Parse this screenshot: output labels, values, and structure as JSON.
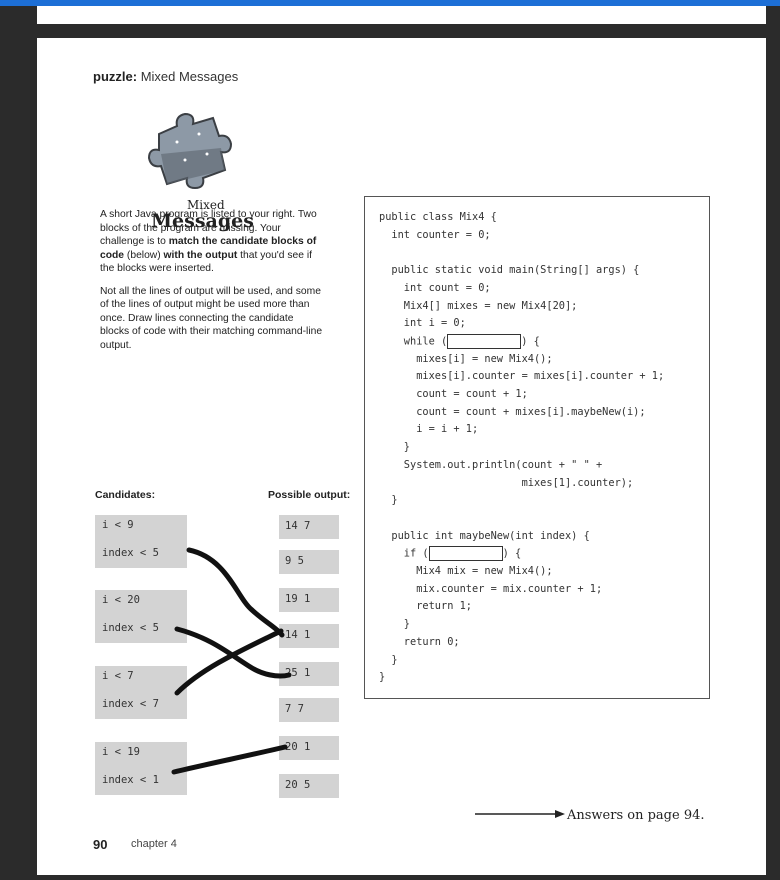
{
  "header": {
    "section": "puzzle:",
    "title": "Mixed Messages"
  },
  "logo": {
    "line1": "Mixed",
    "line2": "Messages"
  },
  "intro": {
    "p1_a": "A short Java program is listed to your right. Two blocks of the program are missing. Your challenge is to ",
    "p1_b": "match the candidate blocks of code",
    "p1_c": " (below) ",
    "p1_d": "with the output",
    "p1_e": " that you'd see if the blocks were inserted.",
    "p2": "Not all the lines of output will be used, and some of the lines of output might be used more than once.  Draw lines connecting the candidate blocks of code with their matching command-line output."
  },
  "code_lines": [
    "public class Mix4 {",
    "  int counter = 0;",
    "",
    "  public static void main(String[] args) {",
    "    int count = 0;",
    "    Mix4[] mixes = new Mix4[20];",
    "    int i = 0;",
    "    while (",
    "      mixes[i] = new Mix4();",
    "      mixes[i].counter = mixes[i].counter + 1;",
    "      count = count + 1;",
    "      count = count + mixes[i].maybeNew(i);",
    "      i = i + 1;",
    "    }",
    "    System.out.println(count + \" \" +",
    "                       mixes[1].counter);",
    "  }",
    "",
    "  public int maybeNew(int index) {",
    "    if (",
    "      Mix4 mix = new Mix4();",
    "      mix.counter = mix.counter + 1;",
    "      return 1;",
    "    }",
    "    return 0;",
    "  }",
    "}"
  ],
  "blank_close": ") {",
  "candidates_label": "Candidates:",
  "output_label": "Possible output:",
  "candidates": [
    {
      "a": "i < 9",
      "b": "index < 5"
    },
    {
      "a": "i < 20",
      "b": "index < 5"
    },
    {
      "a": "i < 7",
      "b": "index < 7"
    },
    {
      "a": "i < 19",
      "b": "index < 1"
    }
  ],
  "outputs": [
    "14 7",
    "9 5",
    "19 1",
    "14 1",
    "25 1",
    "7 7",
    "20 1",
    "20 5"
  ],
  "footer": {
    "page": "90",
    "chapter": "chapter 4"
  },
  "answers": "Answers on page 94.",
  "colors": {
    "accent": "#1d6fd6",
    "box": "#d3d3d3",
    "ink": "#111111"
  }
}
